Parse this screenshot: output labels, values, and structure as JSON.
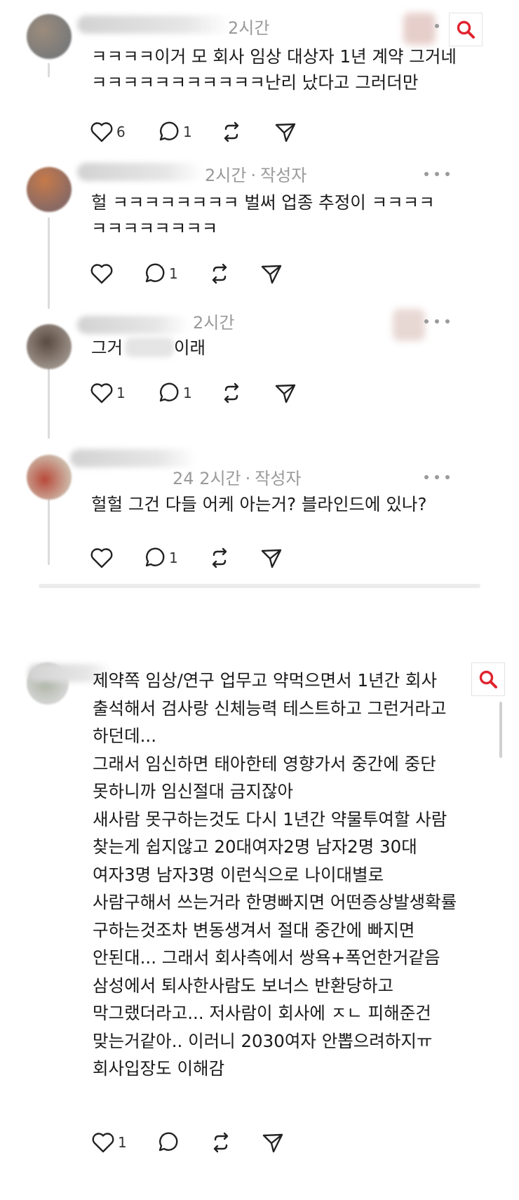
{
  "colors": {
    "search_icon": "#e0232e",
    "meta_gray": "#9a9a9a",
    "text": "#1a1a1a"
  },
  "thread": {
    "comments": [
      {
        "time": "2시간",
        "author_tag": "",
        "lines": [
          "ㅋㅋㅋㅋ이거 모 회사 임상 대상자 1년 계약 그거네",
          "ㅋㅋㅋㅋㅋㅋㅋㅋㅋㅋㅋ난리 났다고 그러더만"
        ],
        "likes": "6",
        "replies": "1"
      },
      {
        "time": "2시간",
        "author_tag": "작성자",
        "lines": [
          "헐 ㅋㅋㅋㅋㅋㅋㅋㅋ 벌써 업종 추정이 ㅋㅋㅋㅋ",
          "ㅋㅋㅋㅋㅋㅋㅋㅋ"
        ],
        "likes": "",
        "replies": "1"
      },
      {
        "time": "2시간",
        "author_tag": "",
        "lines": [
          "그거",
          "이래"
        ],
        "likes": "1",
        "replies": "1"
      },
      {
        "time": "2시간",
        "author_tag": "작성자",
        "name_suffix": "24",
        "lines": [
          "헐헐 그건 다들 어케 아는거? 블라인드에 있나?"
        ],
        "likes": "",
        "replies": "1"
      }
    ],
    "separator": "·"
  },
  "post": {
    "lines": [
      "제약쪽 임상/연구 업무고 약먹으면서 1년간 회사",
      "출석해서 검사랑 신체능력 테스트하고 그런거라고",
      "하던데...",
      "그래서 임신하면 태아한테 영향가서 중간에 중단",
      "못하니까 임신절대 금지잖아",
      "새사람 못구하는것도 다시 1년간 약물투여할 사람",
      "찾는게 쉽지않고 20대여자2명 남자2명 30대",
      "여자3명 남자3명 이런식으로 나이대별로",
      "사람구해서 쓰는거라 한명빠지면 어떤증상발생확률",
      "구하는것조차 변동생겨서 절대 중간에 빠지면",
      "안된대... 그래서 회사측에서 쌍욕+폭언한거같음",
      "삼성에서 퇴사한사람도 보너스 반환당하고",
      "막그랬더라고... 저사람이 회사에 ㅈㄴ 피해준건",
      "맞는거같아.. 이러니 2030여자 안뽑으려하지ㅠ",
      "회사입장도 이해감"
    ],
    "likes": "1",
    "replies": ""
  }
}
